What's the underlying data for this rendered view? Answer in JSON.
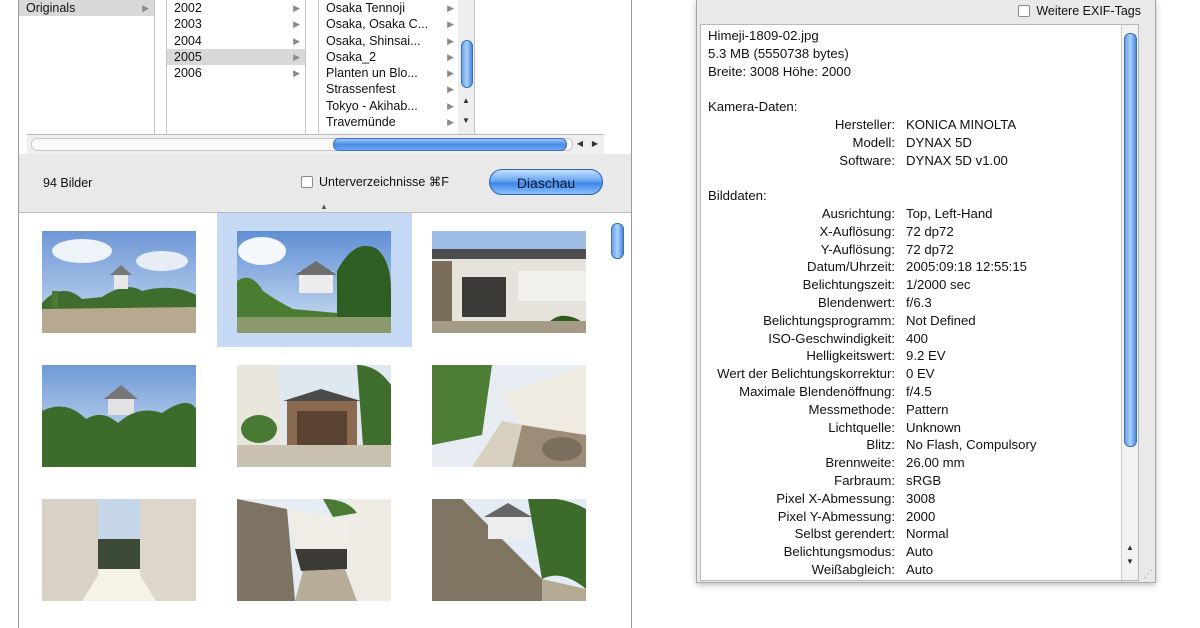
{
  "browser": {
    "col1": [
      {
        "label": "Originals",
        "selected": true
      }
    ],
    "col2": [
      {
        "label": "2002",
        "selected": false
      },
      {
        "label": "2003",
        "selected": false
      },
      {
        "label": "2004",
        "selected": false
      },
      {
        "label": "2005",
        "selected": true
      },
      {
        "label": "2006",
        "selected": false
      }
    ],
    "col3": [
      "Osaka Tennoji",
      "Osaka, Osaka C...",
      "Osaka, Shinsai...",
      "Osaka_2",
      "Planten un Blo...",
      "Strassenfest",
      "Tokyo - Akihab...",
      "Travemünde"
    ]
  },
  "toolbar": {
    "count": "94 Bilder",
    "subdir_label": "Unterverzeichnisse ⌘F",
    "slideshow_label": "Diaschau"
  },
  "thumbnails": {
    "selected_index": 1,
    "items": [
      "castle-far",
      "castle-trees",
      "gate",
      "castle-trees-2",
      "stone-gate",
      "wall-path",
      "corridor",
      "stone-wall-path",
      "stone-wall-castle"
    ]
  },
  "info": {
    "exif_toggle_label": "Weitere EXIF-Tags",
    "file_lines": [
      "Himeji-1809-02.jpg",
      "5.3 MB (5550738 bytes)",
      "Breite: 3008 Höhe: 2000"
    ],
    "camera_heading": "Kamera-Daten:",
    "camera": [
      {
        "k": "Hersteller:",
        "v": "KONICA MINOLTA"
      },
      {
        "k": "Modell:",
        "v": "DYNAX 5D"
      },
      {
        "k": "Software:",
        "v": "DYNAX 5D v1.00"
      }
    ],
    "image_heading": "Bilddaten:",
    "image": [
      {
        "k": "Ausrichtung:",
        "v": "Top, Left-Hand"
      },
      {
        "k": "X-Auflösung:",
        "v": "72 dp72"
      },
      {
        "k": "Y-Auflösung:",
        "v": "72 dp72"
      },
      {
        "k": "Datum/Uhrzeit:",
        "v": "2005:09:18 12:55:15"
      },
      {
        "k": "Belichtungszeit:",
        "v": "1/2000 sec"
      },
      {
        "k": "Blendenwert:",
        "v": "f/6.3"
      },
      {
        "k": "Belichtungsprogramm:",
        "v": "Not Defined"
      },
      {
        "k": "ISO-Geschwindigkeit:",
        "v": "400"
      },
      {
        "k": "Helligkeitswert:",
        "v": "9.2 EV"
      },
      {
        "k": "Wert der Belichtungskorrektur:",
        "v": "0 EV"
      },
      {
        "k": "Maximale Blendenöffnung:",
        "v": "f/4.5"
      },
      {
        "k": "Messmethode:",
        "v": "Pattern"
      },
      {
        "k": "Lichtquelle:",
        "v": "Unknown"
      },
      {
        "k": "Blitz:",
        "v": "No Flash, Compulsory"
      },
      {
        "k": "Brennweite:",
        "v": "26.00 mm"
      },
      {
        "k": "Farbraum:",
        "v": "sRGB"
      },
      {
        "k": "Pixel X-Abmessung:",
        "v": "3008"
      },
      {
        "k": "Pixel Y-Abmessung:",
        "v": "2000"
      },
      {
        "k": "Selbst gerendert:",
        "v": "Normal"
      },
      {
        "k": "Belichtungsmodus:",
        "v": "Auto"
      },
      {
        "k": "Weißabgleich:",
        "v": "Auto"
      }
    ]
  }
}
